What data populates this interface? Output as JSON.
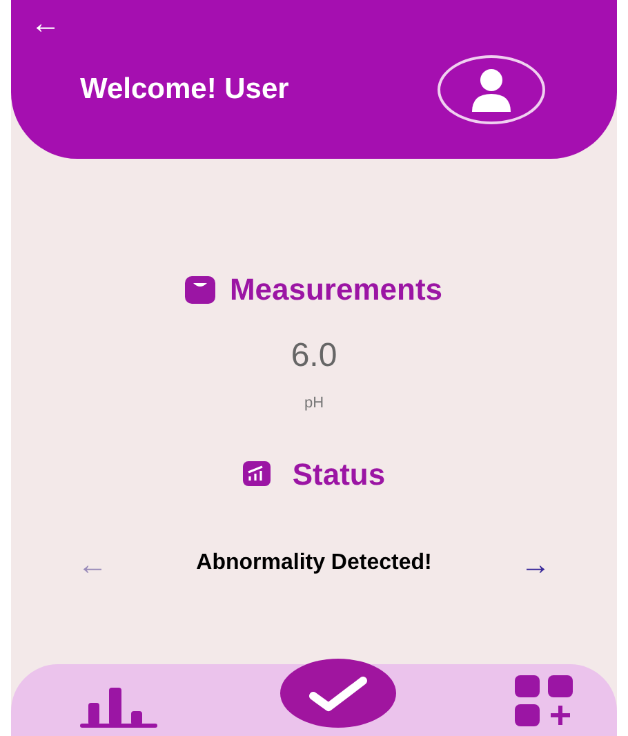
{
  "header": {
    "back": "←",
    "title": "Welcome! User"
  },
  "measurements": {
    "title": "Measurements",
    "value": "6.0",
    "unit": "pH"
  },
  "status": {
    "title": "Status",
    "message": "Abnormality Detected!",
    "prev": {
      "label": "←",
      "disabled": true
    },
    "next": {
      "label": "→",
      "disabled": false
    }
  },
  "nav": [
    {
      "kind": "chart"
    },
    {
      "kind": "check"
    },
    {
      "kind": "add-grid"
    }
  ]
}
